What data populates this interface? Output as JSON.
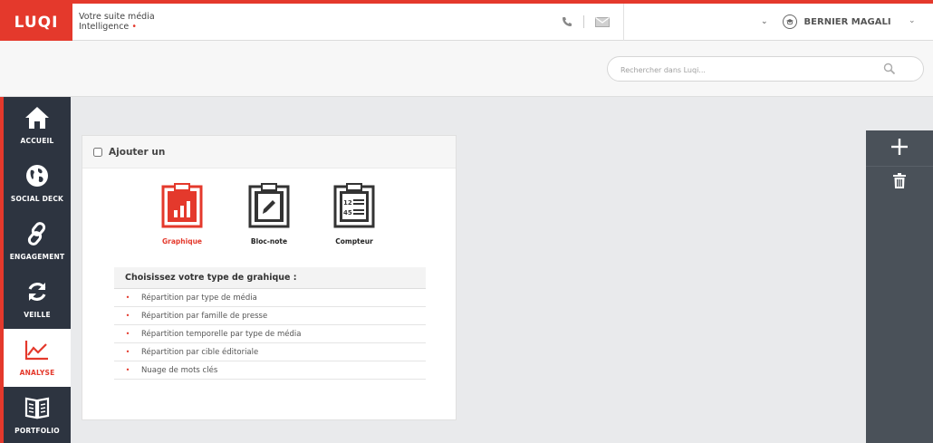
{
  "header": {
    "logo_text": "LUQI",
    "tagline_line1": "Votre suite média",
    "tagline_line2": "Intelligence",
    "tagline_dot": "•",
    "user_name": "BERNIER MAGALI",
    "icons": [
      "phone-icon",
      "mail-icon",
      "chevron-down-icon",
      "user-avatar-icon"
    ]
  },
  "search": {
    "placeholder": "Rechercher dans Luqi..."
  },
  "sidebar": {
    "items": [
      {
        "label": "ACCUEIL",
        "icon": "home-icon"
      },
      {
        "label": "SOCIAL DECK",
        "icon": "globe-icon"
      },
      {
        "label": "ENGAGEMENT",
        "icon": "link-icon"
      },
      {
        "label": "VEILLE",
        "icon": "refresh-icon"
      },
      {
        "label": "ANALYSE",
        "icon": "line-chart-icon",
        "active": true
      },
      {
        "label": "PORTFOLIO",
        "icon": "book-icon"
      }
    ]
  },
  "panel": {
    "title": "Ajouter un",
    "types": [
      {
        "label": "Graphique",
        "icon": "clipboard-chart-icon",
        "active": true
      },
      {
        "label": "Bloc-note",
        "icon": "clipboard-pencil-icon"
      },
      {
        "label": "Compteur",
        "icon": "clipboard-counter-icon"
      }
    ],
    "choices_title": "Choisissez votre type de grahique :",
    "bullet": "•",
    "choices": [
      "Répartition par type de média",
      "Répartition par famille de presse",
      "Répartition temporelle par type de média",
      "Répartition par cible éditoriale",
      "Nuage de mots clés"
    ]
  },
  "right_toolbar": {
    "tools": [
      "plus-icon",
      "trash-icon"
    ]
  },
  "colors": {
    "accent": "#e4392c",
    "sidebar_bg": "#2d3440",
    "toolbar_bg": "#4a5159",
    "page_bg": "#e9eaec"
  }
}
